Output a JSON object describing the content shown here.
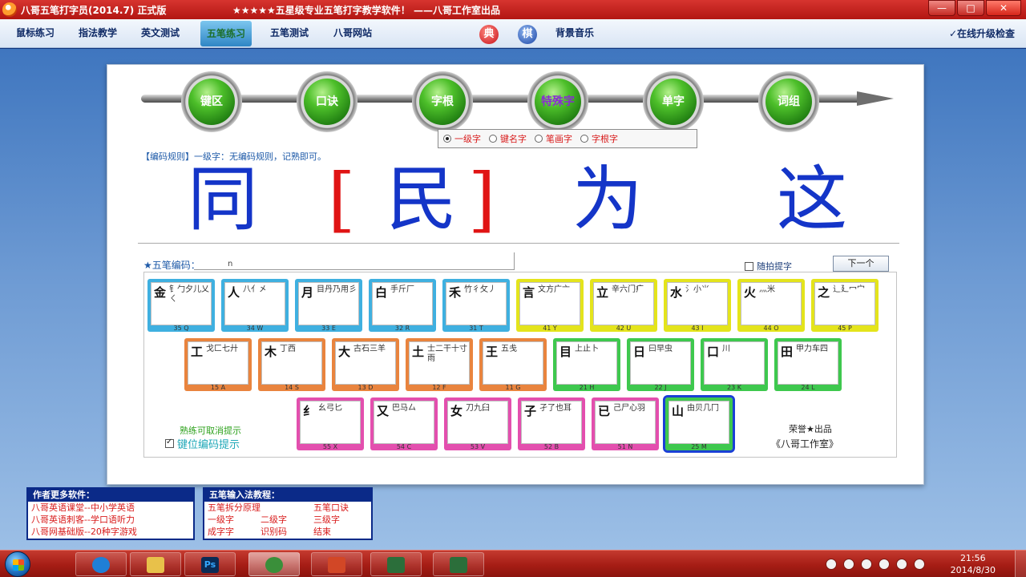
{
  "window": {
    "title": "八哥五笔打字员(2014.7) 正式版",
    "slogan": "★★★★★五星级专业五笔打字教学软件！ ——八哥工作室出品",
    "buttons": {
      "minimize": "—",
      "maximize": "□",
      "close": "✕"
    }
  },
  "menu": {
    "items": [
      "鼠标练习",
      "指法教学",
      "英文测试",
      "五笔练习",
      "五笔测试",
      "八哥网站"
    ],
    "active_index": 3,
    "icon_dian": "典",
    "icon_qi": "棋",
    "music": "背景音乐",
    "upgrade": "✓在线升级检查"
  },
  "steps": [
    "键区",
    "口诀",
    "字根",
    "特殊字",
    "单字",
    "词组"
  ],
  "active_step": 3,
  "char_types": {
    "options": [
      "一级字",
      "键名字",
      "笔画字",
      "字根字"
    ],
    "selected": 0
  },
  "rule_text": "【编码规则】一级字：无编码规则，记熟即可。",
  "practice_chars": [
    "同",
    "民",
    "为",
    "这"
  ],
  "current_index": 1,
  "bracket_left": "[",
  "bracket_right": "]",
  "wubi": {
    "label": "★五笔编码：",
    "code": "n"
  },
  "follow_hint": "随拍提字",
  "next_button": "下一个",
  "keyboard": {
    "rows": [
      [
        {
          "main": "金",
          "roots": "钅勹夕儿乂ㄑ",
          "code": "35 Q",
          "color": "blue"
        },
        {
          "main": "人",
          "roots": "八亻㐅",
          "code": "34 W",
          "color": "blue"
        },
        {
          "main": "月",
          "roots": "目丹乃用彡",
          "code": "33 E",
          "color": "blue"
        },
        {
          "main": "白",
          "roots": "手斤厂",
          "code": "32 R",
          "color": "blue"
        },
        {
          "main": "禾",
          "roots": "竹彳攵丿",
          "code": "31 T",
          "color": "blue"
        },
        {
          "main": "言",
          "roots": "文方广亠",
          "code": "41 Y",
          "color": "yellow"
        },
        {
          "main": "立",
          "roots": "辛六门疒",
          "code": "42 U",
          "color": "yellow"
        },
        {
          "main": "水",
          "roots": "氵小⺌",
          "code": "43 I",
          "color": "yellow"
        },
        {
          "main": "火",
          "roots": "灬米",
          "code": "44 O",
          "color": "yellow"
        },
        {
          "main": "之",
          "roots": "辶廴冖宀",
          "code": "45 P",
          "color": "yellow"
        }
      ],
      [
        {
          "main": "工",
          "roots": "戈匚七廾",
          "code": "15 A",
          "color": "orange"
        },
        {
          "main": "木",
          "roots": "丁西",
          "code": "14 S",
          "color": "orange"
        },
        {
          "main": "大",
          "roots": "古石三羊",
          "code": "13 D",
          "color": "orange"
        },
        {
          "main": "土",
          "roots": "士二干十寸雨",
          "code": "12 F",
          "color": "orange"
        },
        {
          "main": "王",
          "roots": "五戋",
          "code": "11 G",
          "color": "orange"
        },
        {
          "main": "目",
          "roots": "上止卜",
          "code": "21 H",
          "color": "green"
        },
        {
          "main": "日",
          "roots": "曰早虫",
          "code": "22 J",
          "color": "green"
        },
        {
          "main": "口",
          "roots": "川",
          "code": "23 K",
          "color": "green"
        },
        {
          "main": "田",
          "roots": "甲力车四",
          "code": "24 L",
          "color": "green"
        }
      ],
      [
        {
          "main": "纟",
          "roots": "幺弓匕",
          "code": "55 X",
          "color": "pink"
        },
        {
          "main": "又",
          "roots": "巴马厶",
          "code": "54 C",
          "color": "pink"
        },
        {
          "main": "女",
          "roots": "刀九臼",
          "code": "53 V",
          "color": "pink"
        },
        {
          "main": "子",
          "roots": "孑了也耳",
          "code": "52 B",
          "color": "pink"
        },
        {
          "main": "已",
          "roots": "己尸心羽",
          "code": "51 N",
          "color": "pink"
        },
        {
          "main": "山",
          "roots": "由贝几冂",
          "code": "25 M",
          "color": "green"
        }
      ]
    ],
    "selected_key": "25 M"
  },
  "hint_label": "熟练可取消提示",
  "hint_checkbox": "键位编码提示",
  "credit_line1": "荣誉★出品",
  "credit_line2": "《八哥工作室》",
  "more_software": {
    "title": "作者更多软件：",
    "lines": [
      "八哥英语课堂--中小学英语",
      "八哥英语刺客--学口语听力",
      "八哥网基础版--20种字游戏"
    ]
  },
  "tutorial": {
    "title": "五笔输入法教程：",
    "items": [
      "五笔拆分原理",
      "五笔口诀",
      "一级字",
      "二级字",
      "三级字",
      "成字字",
      "识别码",
      "结束"
    ]
  },
  "taskbar": {
    "apps": [
      "ie",
      "folder",
      "ps",
      "parrot",
      "ppt",
      "app1",
      "app2"
    ],
    "ps_label": "Ps",
    "time": "21:56",
    "date": "2014/8/30"
  }
}
